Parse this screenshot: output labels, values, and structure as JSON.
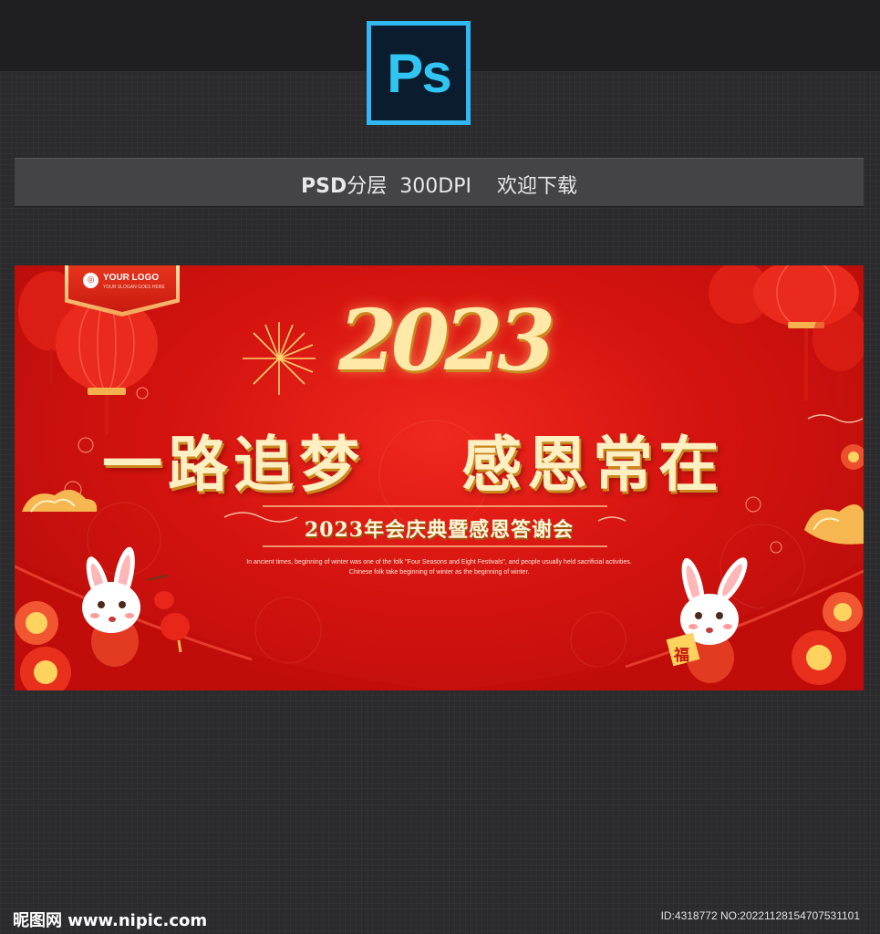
{
  "header": {
    "app_icon": {
      "name": "photoshop-icon",
      "label": "Ps"
    }
  },
  "info_bar": {
    "format": "PSD",
    "layered": "分层",
    "dpi": "300DPI",
    "download": "欢迎下载"
  },
  "banner": {
    "logo": {
      "name": "YOUR LOGO",
      "slogan": "YOUR SLOGAN GOES HERE"
    },
    "year": "2023",
    "headline_left": "一路追梦",
    "headline_right": "感恩常在",
    "subtitle": "2023年会庆典暨感恩答谢会",
    "description_line1": "In ancient times, beginning of winter was one of the folk \"Four Seasons and Eight Festivals\", and people usually held sacrificial activities.",
    "description_line2": "Chinese folk take beginning of winter as the beginning of winter.",
    "fortune_sign": "福",
    "icons": [
      "lantern-icon",
      "firework-icon",
      "cloud-icon",
      "flower-icon",
      "rabbit-icon"
    ],
    "colors": {
      "background": "#d4130f",
      "gold": "#ffe9a8",
      "lantern": "#e8261a"
    }
  },
  "footer": {
    "site": "昵图网 www.nipic.com",
    "id": "ID:4318772 NO:20221128154707531101"
  }
}
